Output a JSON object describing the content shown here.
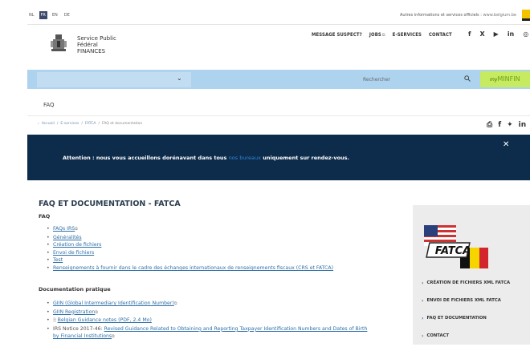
{
  "languages": [
    "NL",
    "FR",
    "EN",
    "DE"
  ],
  "active_language": "FR",
  "other_services": {
    "label": "Autres informations et services officiels :",
    "link": "www.belgium.be"
  },
  "brand": {
    "line1": "Service Public",
    "line2": "Fédéral",
    "line3": "FINANCES"
  },
  "nav": {
    "message_suspect": "MESSAGE SUSPECT?",
    "jobs": "JOBS",
    "eservices": "E-SERVICES",
    "contact": "CONTACT"
  },
  "social": {
    "facebook": "f",
    "x": "X",
    "youtube": "▶",
    "linkedin": "in",
    "instagram": "◎"
  },
  "search": {
    "placeholder": "Rechercher"
  },
  "myminfin": {
    "my": "my",
    "minfin": "MINFIN"
  },
  "page_section": "FAQ",
  "breadcrumb": {
    "home": "Accueil",
    "eservices": "E-services",
    "fatca": "FATCA",
    "current": "FAQ et documentation"
  },
  "alert": {
    "before": "Attention : nous vous accueillons dorénavant dans tous ",
    "highlight": "nos bureaux",
    "after": " uniquement sur rendez-vous."
  },
  "main": {
    "title": "FAQ ET DOCUMENTATION - FATCA",
    "faq_heading": "FAQ",
    "faq_items": [
      "FAQs IRS",
      "Généralités",
      "Création de fichiers",
      "Envoi de fichiers",
      "Test",
      "Renseignements à fournir dans le cadre des échanges internationaux de renseignements fiscaux (CRS et FATCA)"
    ],
    "doc_heading": "Documentation pratique",
    "doc_items": {
      "giin": "GIIN (Global Intermediary Identification Number)",
      "giin_reg": "GIIN Registration",
      "guidance": "Belgian Guidance notes (PDF, 2.4 Mo)",
      "irs_prefix": "IRS Notice 2017-46: ",
      "irs_link": "Revised Guidance Related to Obtaining and Reporting Taxpayer Identification Numbers and Dates of Birth",
      "irs_link2": "by Financial Institutions"
    }
  },
  "sidebar": {
    "logo_text": "FATCA",
    "links": [
      "CRÉATION DE FICHIERS XML FATCA",
      "ENVOI DE FICHIERS XML FATCA",
      "FAQ ET DOCUMENTATION",
      "CONTACT"
    ]
  },
  "colors": {
    "alert_bg": "#0d2b4a",
    "link": "#2e6fa8",
    "search_bar": "#aed3ee",
    "myminfin_bg": "#c6ea60"
  }
}
